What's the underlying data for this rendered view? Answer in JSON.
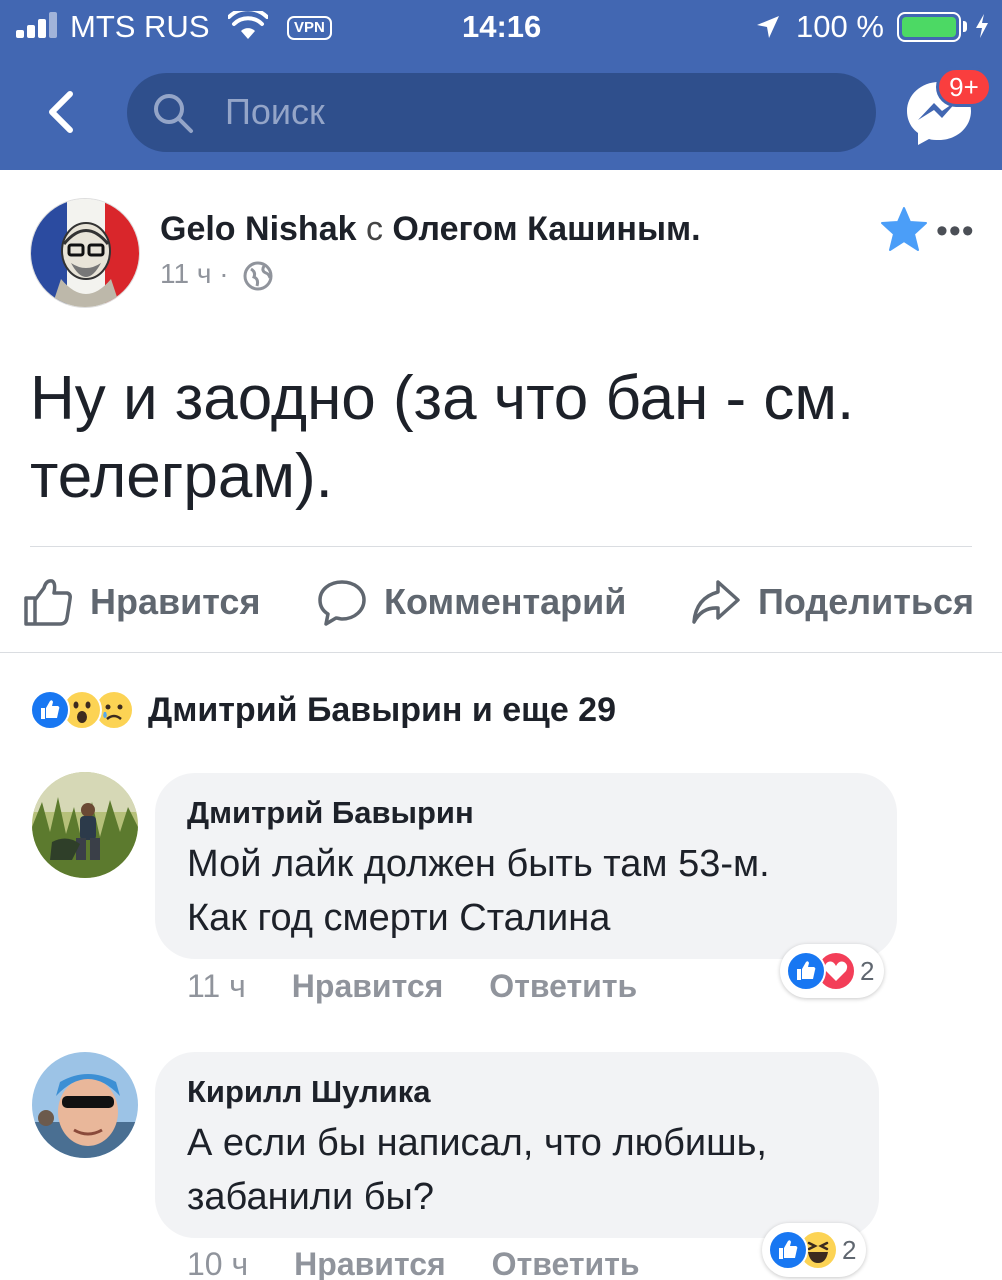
{
  "status_bar": {
    "carrier": "MTS RUS",
    "vpn": "VPN",
    "time": "14:16",
    "battery": "100 %"
  },
  "nav": {
    "search_placeholder": "Поиск",
    "messenger_badge": "9+"
  },
  "colors": {
    "brand": "#4267b2",
    "badge": "#fa3e3e",
    "like_blue": "#1877f2",
    "star": "#4b9ef8"
  },
  "post": {
    "author": "Gelo Nishak",
    "with_word": "с",
    "tagged": "Олегом Кашиным.",
    "time": "11 ч ·",
    "text_line1": "Ну и заодно (за что бан - см.",
    "text_line2": "телеграм).",
    "actions": {
      "like": "Нравится",
      "comment": "Комментарий",
      "share": "Поделиться"
    },
    "reactions_summary": "Дмитрий Бавырин и еще 29",
    "reaction_icons": [
      "like-icon",
      "wow-icon",
      "sad-icon"
    ]
  },
  "comments": [
    {
      "name": "Дмитрий Бавырин",
      "text_line1": "Мой лайк должен быть там 53-м.",
      "text_line2": "Как год смерти Сталина",
      "time": "11 ч",
      "like": "Нравится",
      "reply": "Ответить",
      "reactions_count": "2",
      "reaction_icons": [
        "like-icon",
        "love-icon"
      ]
    },
    {
      "name": "Кирилл Шулика",
      "text_line1": "А если бы написал, что любишь,",
      "text_line2": "забанили бы?",
      "time": "10 ч",
      "like": "Нравится",
      "reply": "Ответить",
      "reactions_count": "2",
      "reaction_icons": [
        "like-icon",
        "haha-icon"
      ]
    }
  ]
}
